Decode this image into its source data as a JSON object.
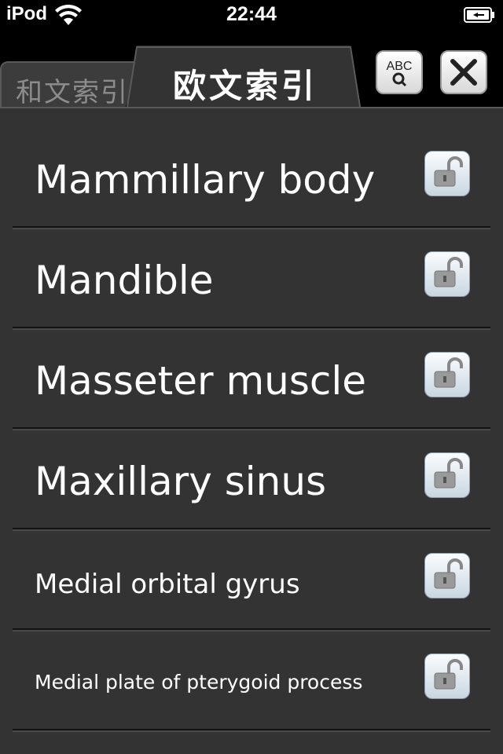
{
  "status_bar": {
    "carrier": "iPod",
    "time": "22:44"
  },
  "tabs": [
    {
      "label": "和文索引",
      "active": false
    },
    {
      "label": "欧文索引",
      "active": true
    }
  ],
  "header_buttons": {
    "search_icon_text": "ABC",
    "search_icon": "abc-search-icon",
    "close_icon": "close-icon"
  },
  "entries": [
    {
      "label": "Mammillary body",
      "icon": "unlock-icon"
    },
    {
      "label": "Mandible",
      "icon": "unlock-icon"
    },
    {
      "label": "Masseter muscle",
      "icon": "unlock-icon"
    },
    {
      "label": "Maxillary sinus",
      "icon": "unlock-icon"
    },
    {
      "label": "Medial orbital gyrus",
      "icon": "unlock-icon"
    },
    {
      "label": "Medial plate of pterygoid process",
      "icon": "unlock-icon"
    }
  ],
  "colors": {
    "background": "#000000",
    "list_background": "#333333",
    "text": "#ffffff",
    "inactive_tab_text": "#8c8c8c"
  }
}
